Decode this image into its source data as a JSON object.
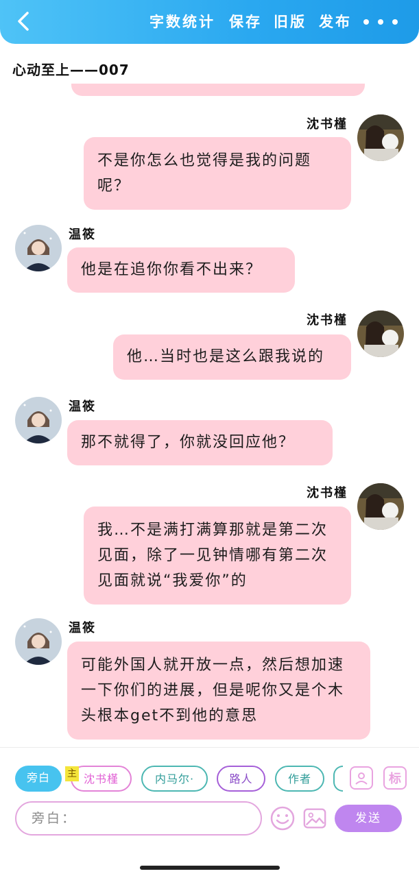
{
  "header": {
    "back_icon": "chevron-left-icon",
    "actions": [
      "字数统计",
      "保存",
      "旧版",
      "发布"
    ],
    "more_icon": "more-dots-icon",
    "gradient": [
      "#4fc3f7",
      "#1e9be8"
    ]
  },
  "doc": {
    "title": "心动至上——007"
  },
  "messages": [
    {
      "sender": "沈书槿",
      "side": "right",
      "text": "不是你怎么也觉得是我的问题呢？"
    },
    {
      "sender": "温筱",
      "side": "left",
      "text": "他是在追你你看不出来？"
    },
    {
      "sender": "沈书槿",
      "side": "right",
      "text": "他…当时也是这么跟我说的"
    },
    {
      "sender": "温筱",
      "side": "left",
      "text": "那不就得了，你就没回应他？"
    },
    {
      "sender": "沈书槿",
      "side": "right",
      "text": "我…不是满打满算那就是第二次见面，除了一见钟情哪有第二次见面就说“我爱你”的"
    },
    {
      "sender": "温筱",
      "side": "left",
      "text": "可能外国人就开放一点，然后想加速一下你们的进展，但是呢你又是个木头根本get不到他的意思"
    }
  ],
  "composer": {
    "roles": [
      "旁白",
      "沈书槿",
      "内马尔·",
      "路人",
      "作者"
    ],
    "main_badge": "主",
    "input_placeholder": "旁白：",
    "send_label": "发送",
    "bubble_color": "#ffd0da",
    "send_color": "#bf86ef"
  }
}
